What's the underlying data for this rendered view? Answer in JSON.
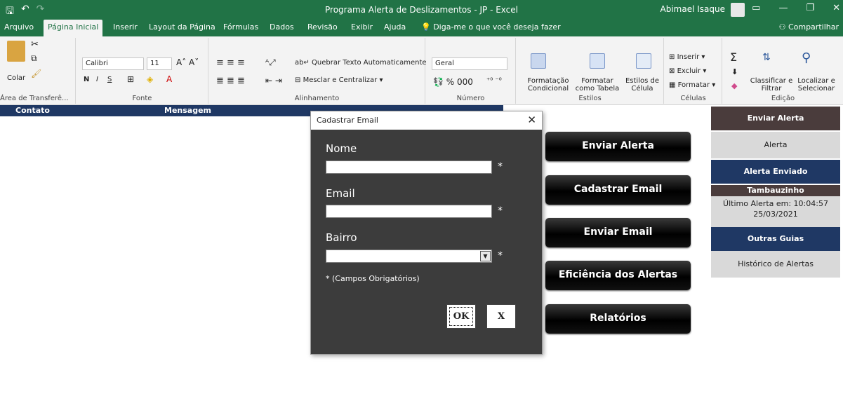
{
  "window": {
    "title": "Programa Alerta de Deslizamentos - JP  -  Excel",
    "user": "Abimael Isaque"
  },
  "tabs": [
    "Arquivo",
    "Página Inicial",
    "Inserir",
    "Layout da Página",
    "Fórmulas",
    "Dados",
    "Revisão",
    "Exibir",
    "Ajuda"
  ],
  "tell_me": "Diga-me o que você deseja fazer",
  "share": "Compartilhar",
  "ribbon": {
    "clipboard": {
      "paste": "Colar",
      "label": "Área de Transferê..."
    },
    "font": {
      "name": "Calibri",
      "size": "11",
      "label": "Fonte"
    },
    "alignment": {
      "wrap": "Quebrar Texto Automaticamente",
      "merge": "Mesclar e Centralizar",
      "label": "Alinhamento"
    },
    "number": {
      "format": "Geral",
      "label": "Número"
    },
    "styles": {
      "cond": "Formatação Condicional",
      "table": "Formatar como Tabela",
      "cell": "Estilos de Célula",
      "label": "Estilos"
    },
    "cells": {
      "insert": "Inserir",
      "delete": "Excluir",
      "format": "Formatar",
      "label": "Células"
    },
    "editing": {
      "sort": "Classificar e Filtrar",
      "find": "Localizar e Selecionar",
      "label": "Edição"
    }
  },
  "sheet": {
    "headers": [
      "Contato",
      "Mensagem"
    ]
  },
  "buttons": [
    "Enviar Alerta",
    "Cadastrar Email",
    "Enviar Email",
    "Eficiência dos Alertas",
    "Relatórios"
  ],
  "panel": {
    "enviar_alerta": "Enviar Alerta",
    "alerta": "Alerta",
    "alerta_enviado": "Alerta Enviado",
    "bairro": "Tambauzinho",
    "ultimo_alerta": "Último Alerta em: 10:04:57",
    "data": "25/03/2021",
    "outras_guias": "Outras Guias",
    "historico": "Histórico de Alertas"
  },
  "dialog": {
    "title": "Cadastrar Email",
    "nome_label": "Nome",
    "email_label": "Email",
    "bairro_label": "Bairro",
    "star": "*",
    "required_note": "* (Campos Obrigatórios)",
    "ok": "OK",
    "cancel": "X",
    "close": "✕"
  },
  "colors": {
    "excel_green": "#217346",
    "header_navy": "#1f3864",
    "panel_dark": "#4a3c3c",
    "dialog_bg": "#3c3c3c"
  }
}
